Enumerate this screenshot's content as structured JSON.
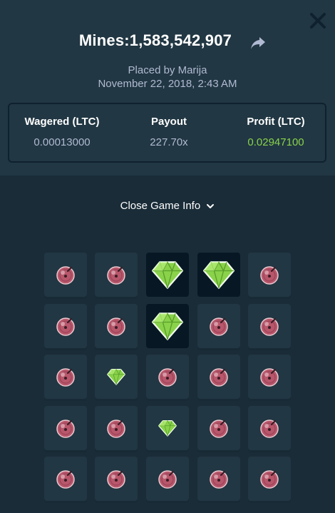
{
  "bet": {
    "game": "Mines",
    "id": "1,583,542,907",
    "title": "Mines:1,583,542,907",
    "placed_by": "Placed by Marija",
    "date": "November 22, 2018, 2:43 AM"
  },
  "stats": {
    "wagered_label": "Wagered (LTC)",
    "wagered_value": "0.00013000",
    "payout_label": "Payout",
    "payout_value": "227.70x",
    "profit_label": "Profit (LTC)",
    "profit_value": "0.02947100"
  },
  "toggle_label": "Close Game Info",
  "icons": {
    "close": "close-icon",
    "share": "share-arrow-icon",
    "toggle": "chevron-down-icon",
    "mine": "mine-icon",
    "gem": "gem-icon"
  },
  "colors": {
    "gem": "#89d24a",
    "mine": "#b8576c",
    "profit": "#89d24a"
  },
  "board": [
    [
      "mine",
      "mine",
      "gem-revealed",
      "gem-revealed",
      "mine"
    ],
    [
      "mine",
      "mine",
      "gem-revealed",
      "mine",
      "mine"
    ],
    [
      "mine",
      "gem",
      "mine",
      "mine",
      "mine"
    ],
    [
      "mine",
      "mine",
      "gem",
      "mine",
      "mine"
    ],
    [
      "mine",
      "mine",
      "mine",
      "mine",
      "mine"
    ]
  ]
}
